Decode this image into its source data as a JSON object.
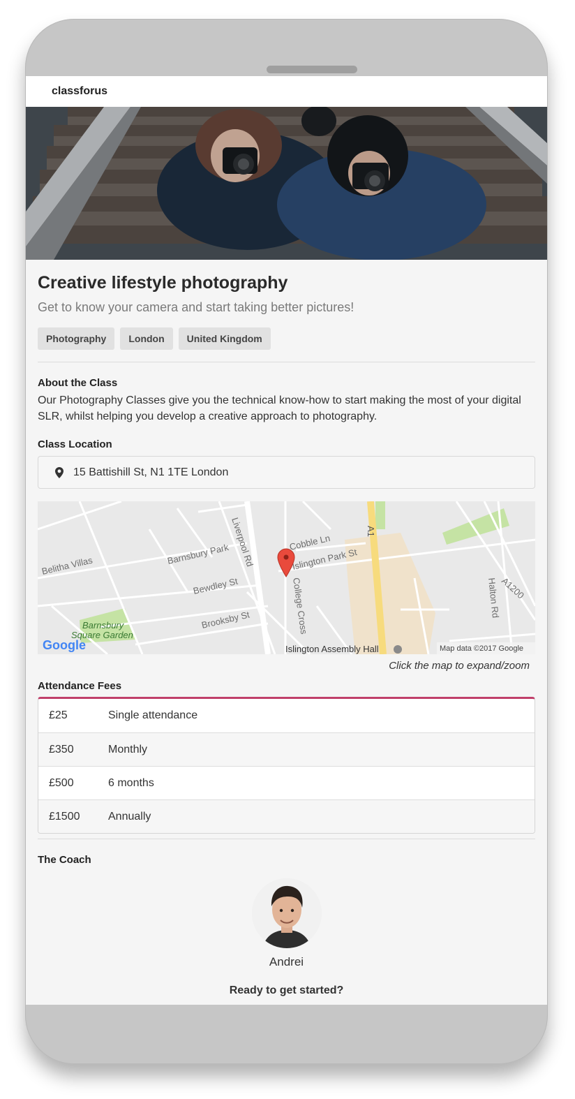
{
  "app": {
    "brand": "classforus"
  },
  "class": {
    "title": "Creative lifestyle photography",
    "subtitle": "Get to know your camera and start taking better pictures!",
    "tags": [
      "Photography",
      "London",
      "United Kingdom"
    ]
  },
  "about": {
    "heading": "About the Class",
    "text": "Our Photography Classes give you the technical know-how to start making the most of your digital SLR, whilst helping you develop a creative approach to photography."
  },
  "location": {
    "heading": "Class Location",
    "address": "15 Battishill St, N1 1TE London",
    "icon": "map-marker-icon"
  },
  "map": {
    "caption": "Click the map to expand/zoom",
    "labels": {
      "belitha": "Belitha Villas",
      "barnsbury_park": "Barnsbury Park",
      "liverpool_rd": "Liverpool Rd",
      "cobble_ln": "Cobble Ln",
      "islington_park": "Islington Park St",
      "a1": "A1",
      "bewdley": "Bewdley St",
      "college_cross": "College Cross",
      "halton_rd": "Halton Rd",
      "a1200": "A1200",
      "brooksby": "Brooksby St",
      "barnsbury_sq_1": "Barnsbury",
      "barnsbury_sq_2": "Square Garden",
      "assembly_hall": "Islington Assembly Hall",
      "logo": "Google",
      "attribution": "Map data ©2017 Google"
    },
    "colors": {
      "road": "#ffffff",
      "land": "#e9e9e9",
      "park": "#c5e3a4",
      "major_road": "#f7db7d",
      "marker": "#e94a3c"
    }
  },
  "fees": {
    "heading": "Attendance Fees",
    "accent": "#c0406a",
    "rows": [
      {
        "price": "£25",
        "label": "Single attendance"
      },
      {
        "price": "£350",
        "label": "Monthly"
      },
      {
        "price": "£500",
        "label": "6 months"
      },
      {
        "price": "£1500",
        "label": "Annually"
      }
    ]
  },
  "coach": {
    "heading": "The Coach",
    "name": "Andrei",
    "cta": "Ready to get started?"
  }
}
